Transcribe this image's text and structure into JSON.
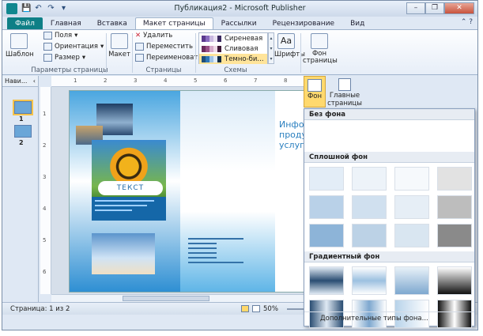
{
  "window": {
    "title": "Публикация2 - Microsoft Publisher",
    "controls": [
      "–",
      "❐",
      "✕"
    ]
  },
  "qat": [
    "💾",
    "↶",
    "↷",
    "▾"
  ],
  "tabs": [
    "Файл",
    "Главная",
    "Вставка",
    "Макет страницы",
    "Рассылки",
    "Рецензирование",
    "Вид"
  ],
  "active_tab": "Макет страницы",
  "ribbon": {
    "template_label": "Шаблон",
    "fields_label": "Поля",
    "orientation_label": "Ориентация",
    "size_label": "Размер",
    "page_params_label": "Параметры страницы",
    "layout_label": "Макет",
    "delete_label": "Удалить",
    "move_label": "Переместить",
    "rename_label": "Переименовать",
    "pages_group_label": "Страницы",
    "schemes": [
      {
        "name": "Сиреневая",
        "colors": [
          "#5b3a8e",
          "#8a6cbf",
          "#c9b8e0",
          "#e9e1f2",
          "#3b2960"
        ]
      },
      {
        "name": "Сливовая",
        "colors": [
          "#6b2c5e",
          "#9a5086",
          "#d6a9c9",
          "#f0dbe8",
          "#3e1837"
        ]
      },
      {
        "name": "Темно-би...",
        "colors": [
          "#1f4e79",
          "#2e75b6",
          "#9dc3e6",
          "#deebf7",
          "#0f2a44"
        ]
      }
    ],
    "schemes_group_label": "Схемы",
    "fonts_label": "Шрифты",
    "page_bg_label": "Фон страницы",
    "bg_label": "Фон",
    "main_pages_label": "Главные страницы"
  },
  "nav": {
    "title": "Нави...",
    "pages": [
      "1",
      "2"
    ]
  },
  "ruler": {
    "top_ticks": [
      "1",
      "2",
      "3",
      "4",
      "5",
      "6",
      "7",
      "8"
    ],
    "left_ticks": [
      "1",
      "2",
      "3",
      "4",
      "5",
      "6"
    ]
  },
  "publication": {
    "text_box": "ТЕКСТ",
    "info_text": [
      "Инфор",
      "продук",
      "услуга"
    ]
  },
  "status": {
    "page_text": "Страница: 1 из 2",
    "zoom": "50%"
  },
  "bg_dropdown": {
    "no_bg_title": "Без фона",
    "solid_title": "Сплошной фон",
    "solid_colors": [
      "#e3edf7",
      "#edf3f9",
      "#f6f9fc",
      "#e2e2e2",
      "#b9d1e8",
      "#d0e0ef",
      "#e6eef6",
      "#bdbdbd",
      "#8db4d8",
      "#bcd2e6",
      "#d9e6f1",
      "#8a8a8a"
    ],
    "gradient_title": "Градиентный фон",
    "more_label": "Дополнительные типы фона..."
  }
}
